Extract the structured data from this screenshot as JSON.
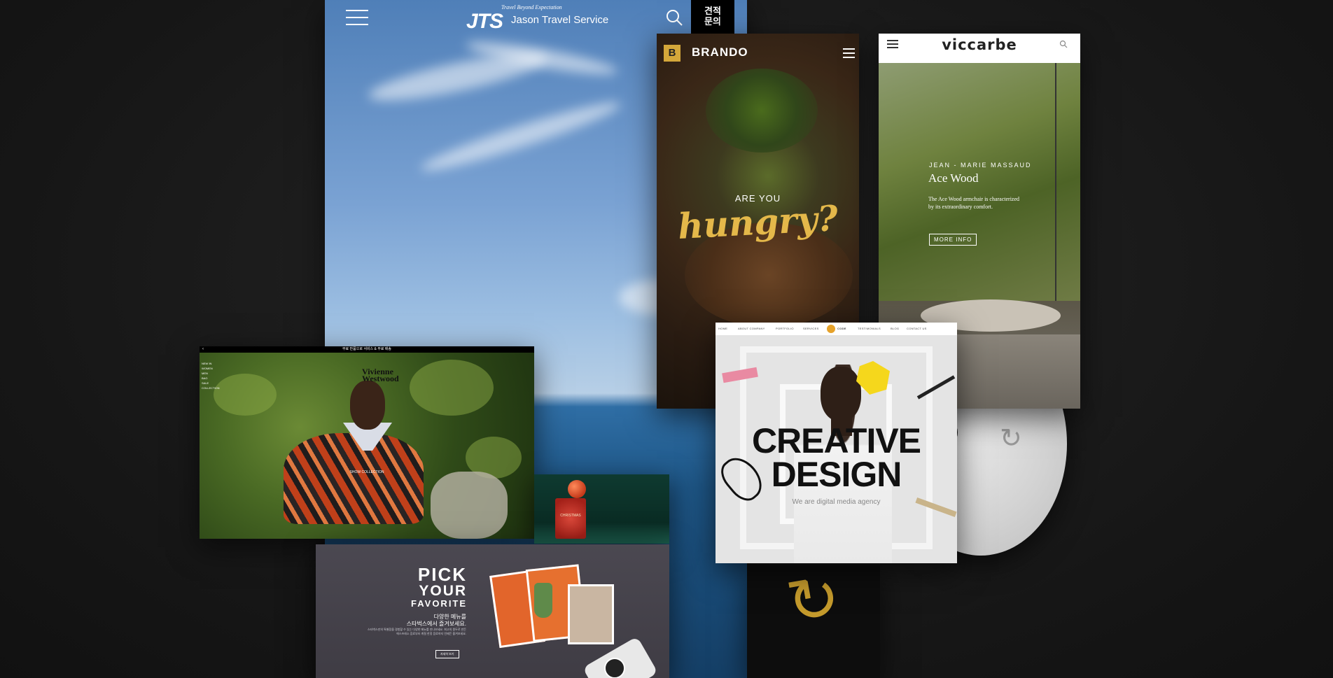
{
  "jts": {
    "tagline": "Travel Beyond Expectation",
    "logo": "JTS",
    "name": "Jason Travel Service",
    "quote_button_line1": "견적",
    "quote_button_line2": "문의"
  },
  "brando": {
    "logo_letter": "B",
    "name": "BRANDO",
    "headline_small": "ARE YOU",
    "headline_script": "hungry?"
  },
  "viccarbe": {
    "logo": "viccarbe",
    "author": "JEAN - MARIE MASSAUD",
    "product": "Ace Wood",
    "description": "The Ace Wood armchair is characterized by its extraordinary comfort.",
    "cta": "MORE INFO"
  },
  "vivienne": {
    "topbar": "무료 반품으로 서비스 & 무료 배송",
    "brand_line1": "Vivienne",
    "brand_line2": "Westwood",
    "nav": [
      "NEW IN",
      "WOMEN",
      "MEN",
      "BAG",
      "SALE",
      "COLLECTION"
    ],
    "collection_label": "SHOW COLLECTION",
    "back": "‹"
  },
  "christmas": {
    "label": "CHRISTMAS"
  },
  "starbucks": {
    "line1": "PICK",
    "line2": "YOUR",
    "line3": "FAVORITE",
    "ko_title1": "다양한 메뉴를",
    "ko_title2": "스타벅스에서 즐겨보세요.",
    "ko_body": "스타벅스만의 특별함을 경험할 수 있는 다양한 메뉴를 만나보세요. 최고의 원두로 만든 에스프레소 음료부터 계절 한정 음료까지 언제든 즐겨보세요.",
    "cta": "자세히 보기"
  },
  "creative": {
    "nav": [
      "HOME",
      "ABOUT COMPANY",
      "PORTFOLIO",
      "SERVICES",
      "TESTIMONIALS",
      "BLOG",
      "CONTACT US"
    ],
    "logo_text": "CODE",
    "title_line1": "CREATIVE",
    "title_line2": "DESIGN",
    "subtitle": "We are digital media agency"
  },
  "icons": [
    "hamburger-icon",
    "search-icon",
    "cd-disc",
    "gold-logo-mark"
  ]
}
